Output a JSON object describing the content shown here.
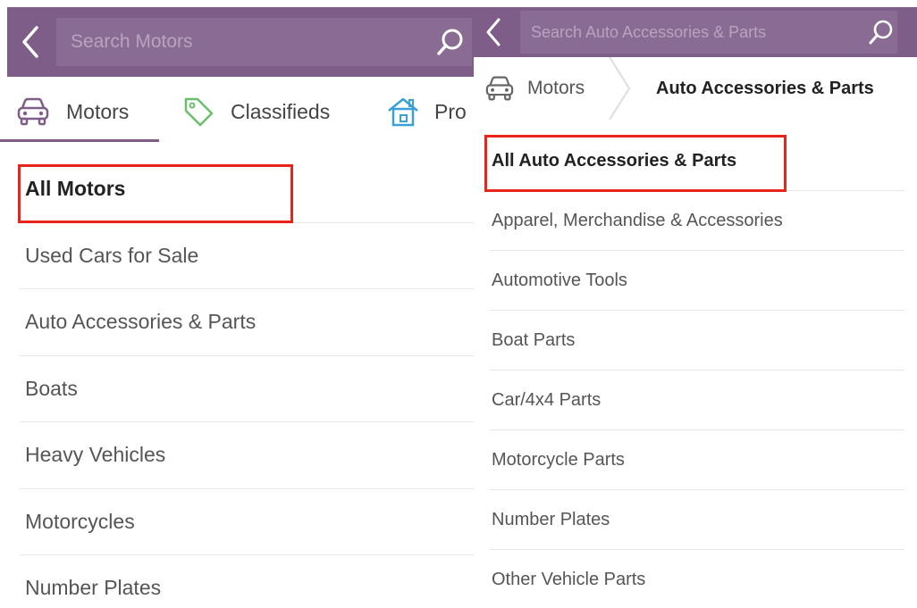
{
  "left": {
    "search": {
      "placeholder": "Search Motors"
    },
    "tabs": [
      {
        "label": "Motors",
        "icon": "car-icon"
      },
      {
        "label": "Classifieds",
        "icon": "tag-icon"
      },
      {
        "label": "Pro",
        "icon": "house-icon"
      }
    ],
    "items": [
      {
        "label": "All Motors",
        "selected": true
      },
      {
        "label": "Used Cars for Sale"
      },
      {
        "label": "Auto Accessories & Parts"
      },
      {
        "label": "Boats"
      },
      {
        "label": "Heavy Vehicles"
      },
      {
        "label": "Motorcycles"
      },
      {
        "label": "Number Plates"
      }
    ]
  },
  "right": {
    "search": {
      "placeholder": "Search Auto Accessories & Parts"
    },
    "breadcrumb": {
      "root": "Motors",
      "current": "Auto Accessories & Parts"
    },
    "items": [
      {
        "label": "All Auto Accessories & Parts",
        "selected": true
      },
      {
        "label": "Apparel, Merchandise & Accessories"
      },
      {
        "label": "Automotive Tools"
      },
      {
        "label": "Boat Parts"
      },
      {
        "label": "Car/4x4 Parts"
      },
      {
        "label": "Motorcycle Parts"
      },
      {
        "label": "Number Plates"
      },
      {
        "label": "Other Vehicle Parts"
      }
    ]
  },
  "colors": {
    "header": "#7e5d88",
    "highlight": "#e8241b",
    "tag_icon": "#6cbf6a",
    "house_icon": "#3aa0d8"
  }
}
